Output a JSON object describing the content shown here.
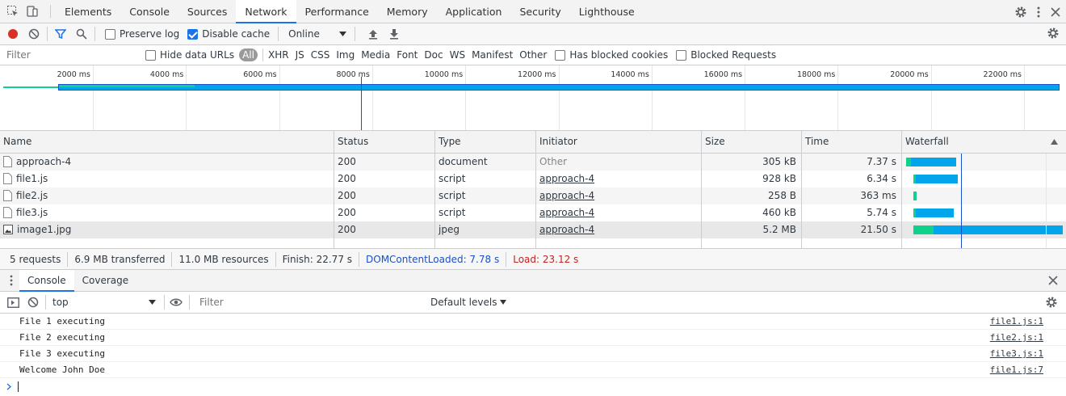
{
  "devtools_tabs": [
    "Elements",
    "Console",
    "Sources",
    "Network",
    "Performance",
    "Memory",
    "Application",
    "Security",
    "Lighthouse"
  ],
  "selected_tab": "Network",
  "toolbar": {
    "preserve_log": "Preserve log",
    "disable_cache": "Disable cache",
    "throttle": "Online"
  },
  "filterbar": {
    "filter_placeholder": "Filter",
    "hide_data_urls": "Hide data URLs",
    "types": [
      "All",
      "XHR",
      "JS",
      "CSS",
      "Img",
      "Media",
      "Font",
      "Doc",
      "WS",
      "Manifest",
      "Other"
    ],
    "has_blocked_cookies": "Has blocked cookies",
    "blocked_requests": "Blocked Requests"
  },
  "overview": {
    "ticks": [
      "2000 ms",
      "4000 ms",
      "6000 ms",
      "8000 ms",
      "10000 ms",
      "12000 ms",
      "14000 ms",
      "16000 ms",
      "18000 ms",
      "20000 ms",
      "22000 ms"
    ]
  },
  "table": {
    "columns": [
      "Name",
      "Status",
      "Type",
      "Initiator",
      "Size",
      "Time",
      "Waterfall"
    ],
    "rows": [
      {
        "name": "approach-4",
        "status": "200",
        "type": "document",
        "initiator": "Other",
        "size": "305 kB",
        "time": "7.37 s",
        "icon": "document-icon"
      },
      {
        "name": "file1.js",
        "status": "200",
        "type": "script",
        "initiator": "approach-4",
        "size": "928 kB",
        "time": "6.34 s",
        "icon": "file-icon"
      },
      {
        "name": "file2.js",
        "status": "200",
        "type": "script",
        "initiator": "approach-4",
        "size": "258 B",
        "time": "363 ms",
        "icon": "file-icon"
      },
      {
        "name": "file3.js",
        "status": "200",
        "type": "script",
        "initiator": "approach-4",
        "size": "460 kB",
        "time": "5.74 s",
        "icon": "file-icon"
      },
      {
        "name": "image1.jpg",
        "status": "200",
        "type": "jpeg",
        "initiator": "approach-4",
        "size": "5.2 MB",
        "time": "21.50 s",
        "icon": "image-icon"
      }
    ]
  },
  "summary": {
    "requests": "5 requests",
    "transferred": "6.9 MB transferred",
    "resources": "11.0 MB resources",
    "finish": "Finish: 22.77 s",
    "dcl": "DOMContentLoaded: 7.78 s",
    "load": "Load: 23.12 s"
  },
  "drawer": {
    "tabs": [
      "Console",
      "Coverage"
    ],
    "context": "top",
    "filter_placeholder": "Filter",
    "levels": "Default levels"
  },
  "console": [
    {
      "text": "File 1 executing",
      "source": "file1.js:1"
    },
    {
      "text": "File 2 executing",
      "source": "file2.js:1"
    },
    {
      "text": "File 3 executing",
      "source": "file3.js:1"
    },
    {
      "text": "Welcome John Doe",
      "source": "file1.js:7"
    }
  ],
  "colors": {
    "accent": "#1a73e8",
    "waterfall_green": "#0ed18a",
    "waterfall_blue": "#00a5ec",
    "dcl_blue": "#1a50c8",
    "load_red": "#c5221f"
  }
}
